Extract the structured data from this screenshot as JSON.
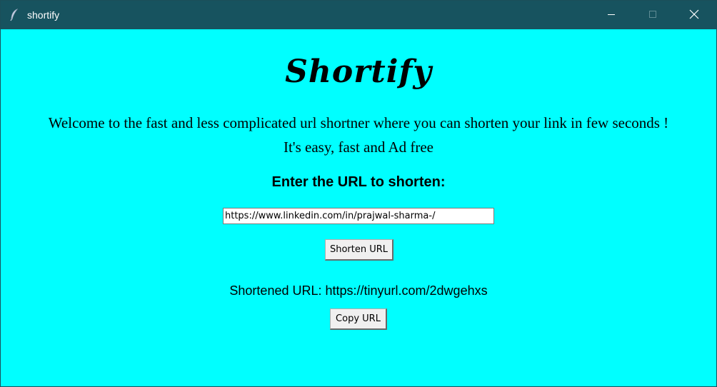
{
  "window": {
    "title": "shortify",
    "icon": "feather-icon",
    "controls": {
      "minimize_icon": "minimize-icon",
      "maximize_icon": "maximize-icon",
      "close_icon": "close-icon"
    }
  },
  "colors": {
    "titlebar": "#17535f",
    "background": "#00ffff",
    "text": "#000000"
  },
  "app": {
    "title": "Shortify",
    "welcome_line1": "Welcome to the fast and less complicated url shortner where you can shorten your link in few seconds !",
    "welcome_line2": "It's easy, fast and Ad free",
    "enter_label": "Enter the URL to shorten:",
    "url_input_value": "https://www.linkedin.com/in/prajwal-sharma-/",
    "shorten_button": "Shorten URL",
    "result_text": "Shortened URL: https://tinyurl.com/2dwgehxs",
    "copy_button": "Copy URL"
  }
}
